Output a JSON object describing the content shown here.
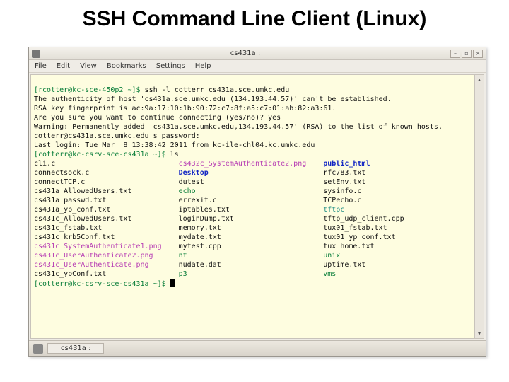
{
  "slide": {
    "title": "SSH Command Line Client (Linux)"
  },
  "window": {
    "title": "cs431a :",
    "menu": [
      "File",
      "Edit",
      "View",
      "Bookmarks",
      "Settings",
      "Help"
    ],
    "minimize_glyph": "–",
    "maximize_glyph": "▫",
    "close_glyph": "×",
    "scroll_up_glyph": "▴",
    "scroll_down_glyph": "▾"
  },
  "taskbar": {
    "button_label": "cs431a :"
  },
  "session": {
    "line1_prompt": "[rcotter@kc-sce-450p2 ~]$ ",
    "line1_cmd": "ssh -l cotterr cs431a.sce.umkc.edu",
    "line2": "The authenticity of host 'cs431a.sce.umkc.edu (134.193.44.57)' can't be established.",
    "line3": "RSA key fingerprint is ac:9a:17:10:1b:90:72:c7:8f:a5:c7:01:ab:82:a3:61.",
    "line4": "Are you sure you want to continue connecting (yes/no)? yes",
    "line5": "Warning: Permanently added 'cs431a.sce.umkc.edu,134.193.44.57' (RSA) to the list of known hosts.",
    "line6": "cotterr@cs431a.sce.umkc.edu's password:",
    "line7": "Last login: Tue Mar  8 13:38:42 2011 from kc-ile-chl04.kc.umkc.edu",
    "line8_prompt": "[cotterr@kc-csrv-sce-cs431a ~]$ ",
    "line8_cmd": "ls",
    "final_prompt": "[cotterr@kc-csrv-sce-cs431a ~]$ "
  },
  "ls": {
    "col1": [
      {
        "t": "cli.c"
      },
      {
        "t": "connectsock.c"
      },
      {
        "t": "connectTCP.c"
      },
      {
        "t": "cs431a_AllowedUsers.txt"
      },
      {
        "t": "cs431a_passwd.txt"
      },
      {
        "t": "cs431a_yp_conf.txt"
      },
      {
        "t": "cs431c_AllowedUsers.txt"
      },
      {
        "t": "cs431c_fstab.txt"
      },
      {
        "t": "cs431c_krb5Conf.txt"
      },
      {
        "t": "cs431c_SystemAuthenticate1.png",
        "c": "mag"
      },
      {
        "t": "cs431c_UserAuthenticate2.png",
        "c": "mag"
      },
      {
        "t": "cs431c_UserAuthenticate.png",
        "c": "mag"
      },
      {
        "t": "cs431c_ypConf.txt"
      }
    ],
    "col2": [
      {
        "t": "cs432c_SystemAuthenticate2.png",
        "c": "mag"
      },
      {
        "t": "Desktop",
        "c": "blue"
      },
      {
        "t": "dutest"
      },
      {
        "t": "echo",
        "c": "green"
      },
      {
        "t": "errexit.c"
      },
      {
        "t": "iptables.txt"
      },
      {
        "t": "loginDump.txt"
      },
      {
        "t": "memory.txt"
      },
      {
        "t": "mydate.txt"
      },
      {
        "t": "mytest.cpp"
      },
      {
        "t": "nt",
        "c": "green"
      },
      {
        "t": "nudate.dat"
      },
      {
        "t": "p3",
        "c": "green"
      }
    ],
    "col3": [
      {
        "t": "public_html",
        "c": "blue"
      },
      {
        "t": "rfc783.txt"
      },
      {
        "t": "setEnv.txt"
      },
      {
        "t": "sysinfo.c"
      },
      {
        "t": "TCPecho.c"
      },
      {
        "t": "tftpc",
        "c": "teal"
      },
      {
        "t": "tftp_udp_client.cpp"
      },
      {
        "t": "tux01_fstab.txt"
      },
      {
        "t": "tux01_yp_conf.txt"
      },
      {
        "t": "tux_home.txt"
      },
      {
        "t": "unix",
        "c": "green"
      },
      {
        "t": "uptime.txt"
      },
      {
        "t": "vms",
        "c": "green"
      }
    ]
  }
}
